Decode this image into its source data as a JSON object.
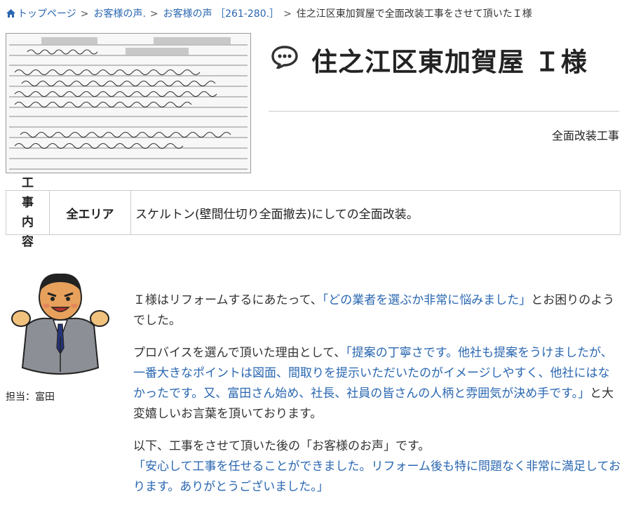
{
  "breadcrumb": {
    "home": "トップページ",
    "level1": "お客様の声.",
    "level2": "お客様の声 ［261-280.］",
    "current": "住之江区東加賀屋で全面改装工事をさせて頂いたＩ様"
  },
  "title": "住之江区東加賀屋 Ｉ様",
  "category": "全面改装工事",
  "work_table": {
    "header": "工事内容",
    "area": "全エリア",
    "description": "スケルトン(壁間仕切り全面撤去)にしての全面改装。"
  },
  "staff": {
    "label": "担当：富田"
  },
  "message": {
    "p1_a": "Ｉ様はリフォームするにあたって、",
    "p1_quote": "「どの業者を選ぶか非常に悩みました」",
    "p1_b": "とお困りのようでした。",
    "p2_a": "プロバイスを選んで頂いた理由として、",
    "p2_quote": "「提案の丁寧さです。他社も提案をうけましたが、一番大きなポイントは図面、間取りを提示いただいたのがイメージしやすく、他社にはなかったです。又、富田さん始め、社長、社員の皆さんの人柄と雰囲気が決め手です。」",
    "p2_b": "と大変嬉しいお言葉を頂いております。",
    "p3_a": "以下、工事をさせて頂いた後の「お客様のお声」です。",
    "p3_quote": "「安心して工事を任せることができました。リフォーム後も特に問題なく非常に満足しております。ありがとうございました。」"
  },
  "colors": {
    "link": "#2a67b1",
    "text": "#333333"
  }
}
